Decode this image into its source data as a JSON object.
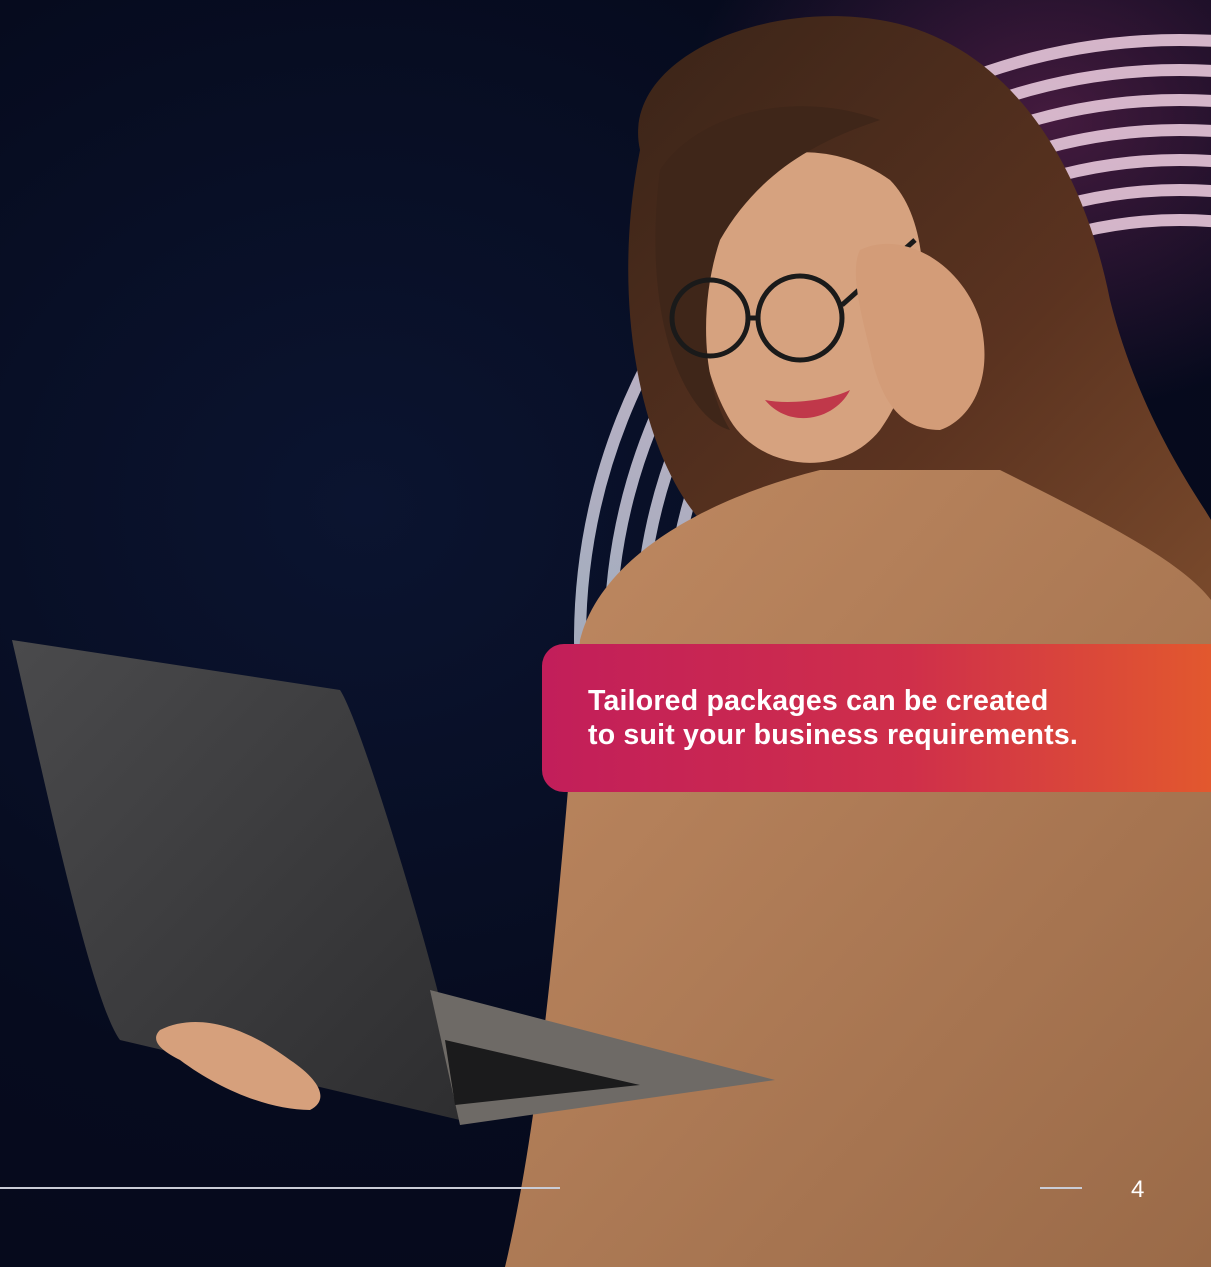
{
  "callout": {
    "line1": "Tailored packages can be created",
    "line2": "to suit your business requirements."
  },
  "footer": {
    "page_number": "4"
  },
  "colors": {
    "background": "#060b1e",
    "callout_start": "#c21e5a",
    "callout_end": "#e2582e",
    "text": "#ffffff",
    "sweater": "#b07a55"
  },
  "images": {
    "hero_photo": "woman-with-glasses-holding-laptop"
  }
}
